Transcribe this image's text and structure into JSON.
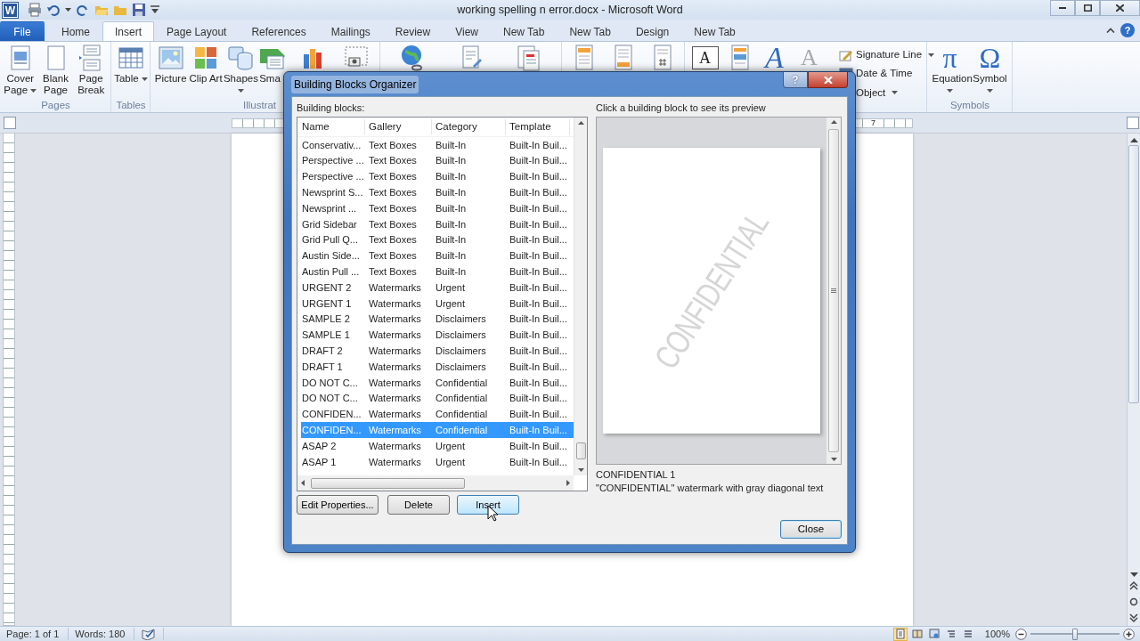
{
  "window": {
    "app_letter": "W",
    "title": "working spelling n error.docx - Microsoft Word"
  },
  "tabs": [
    {
      "label": "File",
      "kind": "file",
      "selected": false
    },
    {
      "label": "Home",
      "kind": "tab",
      "selected": false
    },
    {
      "label": "Insert",
      "kind": "tab",
      "selected": true
    },
    {
      "label": "Page Layout",
      "kind": "tab",
      "selected": false
    },
    {
      "label": "References",
      "kind": "tab",
      "selected": false
    },
    {
      "label": "Mailings",
      "kind": "tab",
      "selected": false
    },
    {
      "label": "Review",
      "kind": "tab",
      "selected": false
    },
    {
      "label": "View",
      "kind": "tab",
      "selected": false
    },
    {
      "label": "New Tab",
      "kind": "tab",
      "selected": false
    },
    {
      "label": "New Tab",
      "kind": "tab",
      "selected": false
    },
    {
      "label": "Design",
      "kind": "tab",
      "selected": false
    },
    {
      "label": "New Tab",
      "kind": "tab",
      "selected": false
    }
  ],
  "help": {
    "label": "?"
  },
  "ribbon": {
    "groups": [
      {
        "label": "Pages",
        "items": [
          {
            "kind": "cover",
            "label": "Cover Page",
            "dropdown": true
          },
          {
            "kind": "blank",
            "label": "Blank Page",
            "dropdown": false
          },
          {
            "kind": "pagebreak",
            "label": "Page Break",
            "dropdown": false
          }
        ]
      },
      {
        "label": "Tables",
        "items": [
          {
            "kind": "table",
            "label": "Table",
            "dropdown": true
          }
        ]
      },
      {
        "label": "Illustrat",
        "items": [
          {
            "kind": "picture",
            "label": "Picture",
            "dropdown": false
          },
          {
            "kind": "clipart",
            "label": "Clip Art",
            "dropdown": false
          },
          {
            "kind": "shapes",
            "label": "Shapes",
            "dropdown": true
          },
          {
            "kind": "smartart",
            "label": "Sma",
            "dropdown": false
          },
          {
            "kind": "chart"
          },
          {
            "kind": "screenshot"
          }
        ]
      },
      {
        "items": [
          {
            "kind": "hyperlink"
          },
          {
            "kind": "bookmark"
          },
          {
            "kind": "crossref"
          }
        ]
      },
      {
        "items": [
          {
            "kind": "header"
          },
          {
            "kind": "footer"
          },
          {
            "kind": "pagenumber"
          }
        ]
      },
      {
        "items": [
          {
            "kind": "textbox",
            "glyph": "A"
          },
          {
            "kind": "quickparts"
          },
          {
            "kind": "wordart",
            "glyph": "A"
          },
          {
            "kind": "dropcap",
            "glyph": "A"
          }
        ],
        "small_items": [
          {
            "kind": "signature",
            "label": "Signature Line",
            "dropdown": true
          },
          {
            "kind": "datetime",
            "label": "Date & Time",
            "dropdown": false
          },
          {
            "kind": "object",
            "label": "Object",
            "dropdown": true
          }
        ]
      },
      {
        "label": "Symbols",
        "items": [
          {
            "kind": "equation",
            "glyph": "π",
            "label": "Equation",
            "dropdown": true
          },
          {
            "kind": "symbol",
            "glyph": "Ω",
            "label": "Symbol",
            "dropdown": true
          }
        ]
      }
    ]
  },
  "ruler": {
    "label": "7"
  },
  "organizer": {
    "title": "Building Blocks Organizer",
    "help_label": "?",
    "list_label": "Building blocks:",
    "columns": [
      "Name",
      "Gallery",
      "Category",
      "Template"
    ],
    "rows": [
      {
        "cells": [
          "Conservativ...",
          "Text Boxes",
          "Built-In",
          "Built-In Buil..."
        ],
        "selected": false
      },
      {
        "cells": [
          "Perspective ...",
          "Text Boxes",
          "Built-In",
          "Built-In Buil..."
        ],
        "selected": false
      },
      {
        "cells": [
          "Perspective ...",
          "Text Boxes",
          "Built-In",
          "Built-In Buil..."
        ],
        "selected": false
      },
      {
        "cells": [
          "Newsprint S...",
          "Text Boxes",
          "Built-In",
          "Built-In Buil..."
        ],
        "selected": false
      },
      {
        "cells": [
          "Newsprint ...",
          "Text Boxes",
          "Built-In",
          "Built-In Buil..."
        ],
        "selected": false
      },
      {
        "cells": [
          "Grid Sidebar",
          "Text Boxes",
          "Built-In",
          "Built-In Buil..."
        ],
        "selected": false
      },
      {
        "cells": [
          "Grid Pull Q...",
          "Text Boxes",
          "Built-In",
          "Built-In Buil..."
        ],
        "selected": false
      },
      {
        "cells": [
          "Austin Side...",
          "Text Boxes",
          "Built-In",
          "Built-In Buil..."
        ],
        "selected": false
      },
      {
        "cells": [
          "Austin Pull ...",
          "Text Boxes",
          "Built-In",
          "Built-In Buil..."
        ],
        "selected": false
      },
      {
        "cells": [
          "URGENT 2",
          "Watermarks",
          "Urgent",
          "Built-In Buil..."
        ],
        "selected": false
      },
      {
        "cells": [
          "URGENT 1",
          "Watermarks",
          "Urgent",
          "Built-In Buil..."
        ],
        "selected": false
      },
      {
        "cells": [
          "SAMPLE 2",
          "Watermarks",
          "Disclaimers",
          "Built-In Buil..."
        ],
        "selected": false
      },
      {
        "cells": [
          "SAMPLE 1",
          "Watermarks",
          "Disclaimers",
          "Built-In Buil..."
        ],
        "selected": false
      },
      {
        "cells": [
          "DRAFT 2",
          "Watermarks",
          "Disclaimers",
          "Built-In Buil..."
        ],
        "selected": false
      },
      {
        "cells": [
          "DRAFT 1",
          "Watermarks",
          "Disclaimers",
          "Built-In Buil..."
        ],
        "selected": false
      },
      {
        "cells": [
          "DO NOT C...",
          "Watermarks",
          "Confidential",
          "Built-In Buil..."
        ],
        "selected": false
      },
      {
        "cells": [
          "DO NOT C...",
          "Watermarks",
          "Confidential",
          "Built-In Buil..."
        ],
        "selected": false
      },
      {
        "cells": [
          "CONFIDEN...",
          "Watermarks",
          "Confidential",
          "Built-In Buil..."
        ],
        "selected": false
      },
      {
        "cells": [
          "CONFIDEN...",
          "Watermarks",
          "Confidential",
          "Built-In Buil..."
        ],
        "selected": true
      },
      {
        "cells": [
          "ASAP 2",
          "Watermarks",
          "Urgent",
          "Built-In Buil..."
        ],
        "selected": false
      },
      {
        "cells": [
          "ASAP 1",
          "Watermarks",
          "Urgent",
          "Built-In Buil..."
        ],
        "selected": false
      }
    ],
    "buttons": [
      {
        "label": "Edit Properties...",
        "hover": false
      },
      {
        "label": "Delete",
        "hover": false
      },
      {
        "label": "Insert",
        "hover": true
      }
    ],
    "preview_label": "Click a building block to see its preview",
    "preview_watermark": "CONFIDENTIAL",
    "selected_name": "CONFIDENTIAL 1",
    "selected_description": "\"CONFIDENTIAL\" watermark with gray diagonal text",
    "close_label": "Close"
  },
  "status_bar": {
    "page": "Page: 1 of 1",
    "words": "Words: 180",
    "views": [
      {
        "selected": true
      },
      {
        "selected": false
      },
      {
        "selected": false
      },
      {
        "selected": false
      },
      {
        "selected": false
      }
    ],
    "zoom": "100%",
    "zoom_slider": {
      "level": 0.5
    }
  }
}
